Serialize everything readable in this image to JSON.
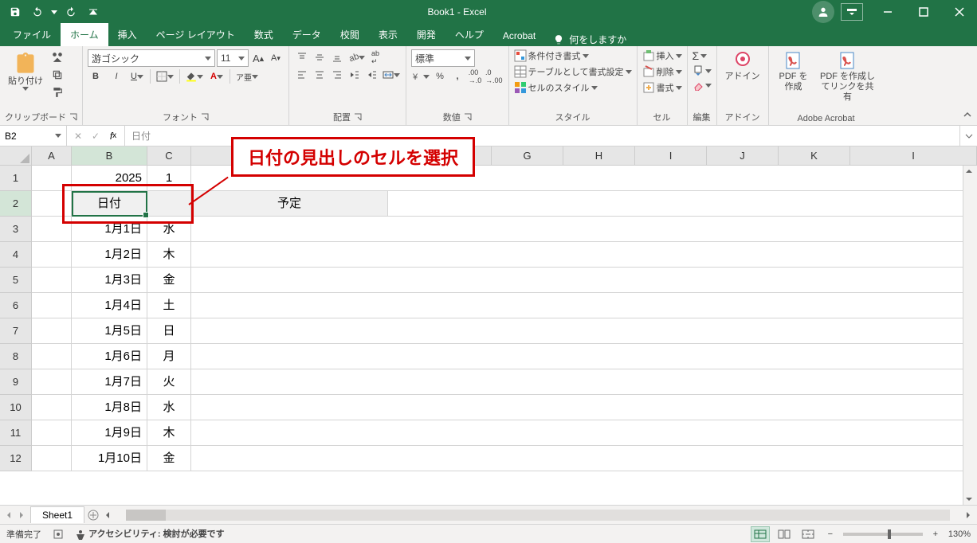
{
  "app": {
    "title": "Book1  -  Excel"
  },
  "tabs": {
    "file": "ファイル",
    "home": "ホーム",
    "insert": "挿入",
    "pagelayout": "ページ レイアウト",
    "formulas": "数式",
    "data": "データ",
    "review": "校閲",
    "view": "表示",
    "developer": "開発",
    "help": "ヘルプ",
    "acrobat": "Acrobat",
    "tell_me": "何をしますか"
  },
  "ribbon": {
    "clipboard": {
      "label": "クリップボード",
      "paste": "貼り付け"
    },
    "font": {
      "label": "フォント",
      "name": "游ゴシック",
      "size": "11"
    },
    "alignment": {
      "label": "配置"
    },
    "number": {
      "label": "数値",
      "format": "標準"
    },
    "styles": {
      "label": "スタイル",
      "cond": "条件付き書式",
      "table": "テーブルとして書式設定",
      "cell": "セルのスタイル"
    },
    "cells": {
      "label": "セル",
      "insert": "挿入",
      "delete": "削除",
      "format": "書式"
    },
    "editing": {
      "label": "編集"
    },
    "addin": {
      "label": "アドイン",
      "btn": "アドイン"
    },
    "acrobat": {
      "label": "Adobe Acrobat",
      "create": "PDF を作成",
      "share": "PDF を作成してリンクを共有"
    }
  },
  "formula_bar": {
    "name_box": "B2",
    "formula": "日付"
  },
  "columns": [
    "A",
    "B",
    "C",
    "",
    "",
    "",
    "G",
    "H",
    "I",
    "J",
    "K",
    "I"
  ],
  "rows": [
    {
      "n": "1",
      "A": "",
      "B": "2025",
      "C": "1"
    },
    {
      "n": "2",
      "A": "",
      "B": "日付",
      "C": "",
      "merged": "予定"
    },
    {
      "n": "3",
      "A": "",
      "B": "1月1日",
      "C": "水"
    },
    {
      "n": "4",
      "A": "",
      "B": "1月2日",
      "C": "木"
    },
    {
      "n": "5",
      "A": "",
      "B": "1月3日",
      "C": "金"
    },
    {
      "n": "6",
      "A": "",
      "B": "1月4日",
      "C": "土"
    },
    {
      "n": "7",
      "A": "",
      "B": "1月5日",
      "C": "日"
    },
    {
      "n": "8",
      "A": "",
      "B": "1月6日",
      "C": "月"
    },
    {
      "n": "9",
      "A": "",
      "B": "1月7日",
      "C": "火"
    },
    {
      "n": "10",
      "A": "",
      "B": "1月8日",
      "C": "水"
    },
    {
      "n": "11",
      "A": "",
      "B": "1月9日",
      "C": "木"
    },
    {
      "n": "12",
      "A": "",
      "B": "1月10日",
      "C": "金"
    }
  ],
  "annotation": {
    "text": "日付の見出しのセルを選択"
  },
  "sheet": {
    "name": "Sheet1"
  },
  "status": {
    "ready": "準備完了",
    "accessibility": "アクセシビリティ: 検討が必要です",
    "zoom": "130%"
  }
}
